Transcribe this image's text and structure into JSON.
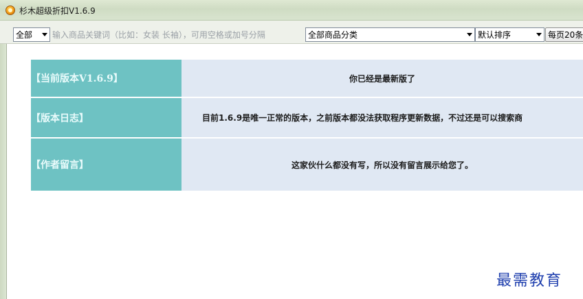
{
  "window": {
    "title": "杉木超级折扣V1.6.9",
    "icon": "app-orange-circle-icon"
  },
  "toolbar": {
    "scope_select": {
      "value": "全部"
    },
    "search": {
      "placeholder": "输入商品关键词（比如：女装 长袖），可用空格或加号分隔",
      "value": ""
    },
    "category_select": {
      "value": "全部商品分类"
    },
    "sort_select": {
      "value": "默认排序"
    },
    "per_page_label": "每页20条"
  },
  "info": {
    "rows": [
      {
        "label": "【当前版本V1.6.9】",
        "value": "你已经是最新版了"
      },
      {
        "label": "【版本日志】",
        "value": "目前1.6.9是唯一正常的版本，之前版本都没法获取程序更新数据，不过还是可以搜索商"
      },
      {
        "label": "【作者留言】",
        "value": "这家伙什么都没有写，所以没有留言展示给您了。"
      }
    ]
  },
  "watermark": "最需教育",
  "colors": {
    "label_bg": "#6ec2c3",
    "value_bg": "#e0e8f3",
    "watermark": "#1f3fae"
  }
}
